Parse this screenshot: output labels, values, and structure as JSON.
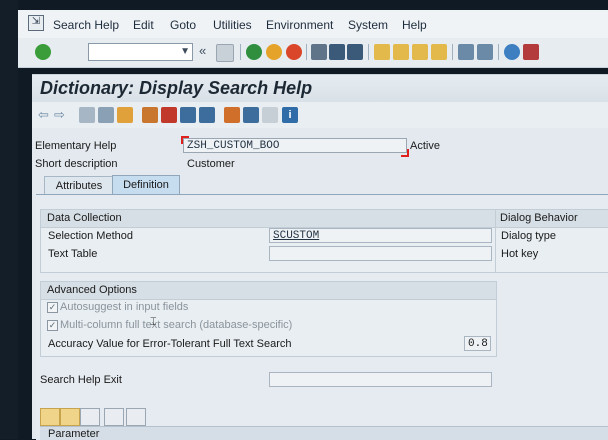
{
  "menu": {
    "items": [
      "Search Help",
      "Edit",
      "Goto",
      "Utilities",
      "Environment",
      "System",
      "Help"
    ]
  },
  "toolbar": {
    "command_field_value": "",
    "nav_arrow": "«"
  },
  "title": "Dictionary: Display Search Help",
  "header": {
    "elementary_help_label": "Elementary Help",
    "elementary_help_value": "ZSH_CUSTOM_BOO",
    "status": "Active",
    "short_description_label": "Short description",
    "short_description_value": "Customer"
  },
  "tabs": [
    {
      "label": "Attributes",
      "active": false
    },
    {
      "label": "Definition",
      "active": true
    }
  ],
  "data_collection": {
    "heading": "Data Collection",
    "selection_method_label": "Selection Method",
    "selection_method_value": "SCUSTOM",
    "text_table_label": "Text Table",
    "text_table_value": ""
  },
  "dialog_behavior": {
    "heading": "Dialog Behavior",
    "dialog_type_label": "Dialog type",
    "hot_key_label": "Hot key"
  },
  "advanced": {
    "heading": "Advanced Options",
    "autosuggest_label": "Autosuggest in input fields",
    "multicolumn_label": "Multi-column full text search (database-specific)",
    "accuracy_label": "Accuracy Value for Error-Tolerant Full Text Search",
    "accuracy_value": "0.8"
  },
  "exit": {
    "label": "Search Help Exit",
    "value": ""
  },
  "params": {
    "header": "Parameter"
  },
  "colors": {
    "title_bg": "#dce4ea",
    "active_tab": "#c6dcef",
    "required_marker": "#e0201c"
  }
}
